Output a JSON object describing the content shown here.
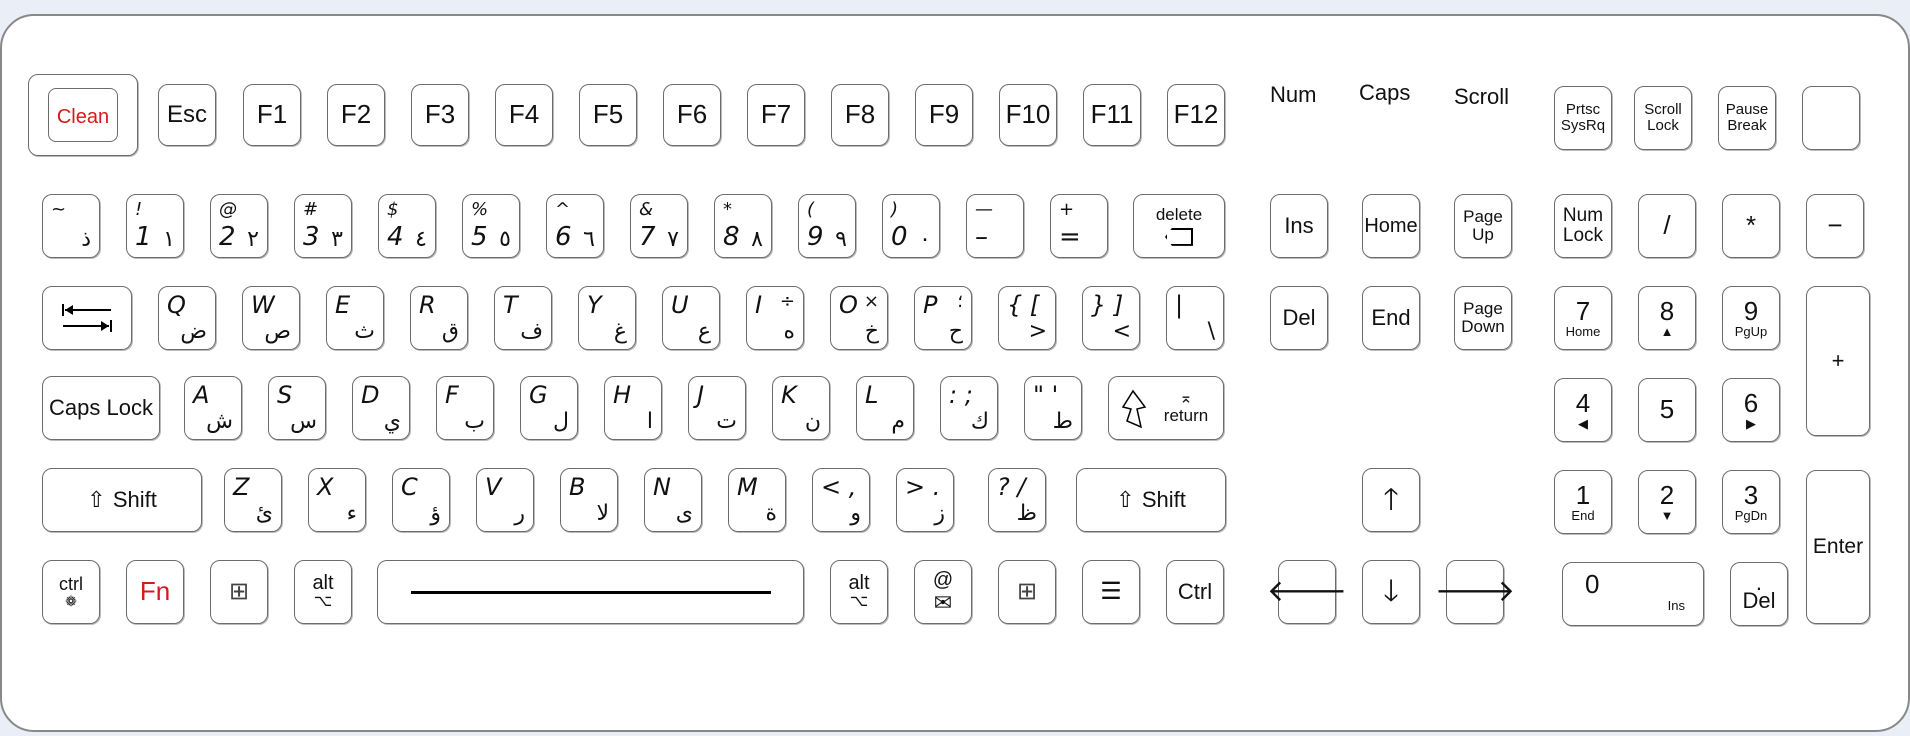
{
  "indicators": {
    "num": "Num",
    "caps": "Caps",
    "scroll": "Scroll"
  },
  "fkeys": {
    "clean": "Clean",
    "esc": "Esc",
    "f1": "F1",
    "f2": "F2",
    "f3": "F3",
    "f4": "F4",
    "f5": "F5",
    "f6": "F6",
    "f7": "F7",
    "f8": "F8",
    "f9": "F9",
    "f10": "F10",
    "f11": "F11",
    "f12": "F12"
  },
  "sys": {
    "prtsc": "Prtsc",
    "sysrq": "SysRq",
    "scroll": "Scroll",
    "lock": "Lock",
    "pause": "Pause",
    "break": "Break"
  },
  "numrow": [
    {
      "t": "~",
      "l": "",
      "ar": "ذ"
    },
    {
      "t": "!",
      "l": "1",
      "ar": "١"
    },
    {
      "t": "@",
      "l": "2",
      "ar": "٢"
    },
    {
      "t": "#",
      "l": "3",
      "ar": "٣"
    },
    {
      "t": "$",
      "l": "4",
      "ar": "٤"
    },
    {
      "t": "%",
      "l": "5",
      "ar": "٥"
    },
    {
      "t": "^",
      "l": "6",
      "ar": "٦"
    },
    {
      "t": "&",
      "l": "7",
      "ar": "٧"
    },
    {
      "t": "*",
      "l": "8",
      "ar": "٨"
    },
    {
      "t": "(",
      "l": "9",
      "ar": "٩"
    },
    {
      "t": ")",
      "l": "0",
      "ar": "٠"
    },
    {
      "t": "—",
      "l": "–",
      "ar": ""
    },
    {
      "t": "+",
      "l": "=",
      "ar": ""
    }
  ],
  "delete_label": "delete",
  "qrow": [
    {
      "l": "Q",
      "ar": "ض",
      "tr": ""
    },
    {
      "l": "W",
      "ar": "ص",
      "tr": ""
    },
    {
      "l": "E",
      "ar": "ث",
      "tr": ""
    },
    {
      "l": "R",
      "ar": "ق",
      "tr": ""
    },
    {
      "l": "T",
      "ar": "ف",
      "tr": ""
    },
    {
      "l": "Y",
      "ar": "غ",
      "tr": ""
    },
    {
      "l": "U",
      "ar": "ع",
      "tr": ""
    },
    {
      "l": "I",
      "ar": "ه",
      "tr": "÷"
    },
    {
      "l": "O",
      "ar": "خ",
      "tr": "×"
    },
    {
      "l": "P",
      "ar": "ح",
      "tr": "؛"
    },
    {
      "l": "{ [",
      "ar": ">",
      "tr": ""
    },
    {
      "l": "} ]",
      "ar": "<",
      "tr": ""
    },
    {
      "l": "|",
      "ar": "\\",
      "tr": ""
    }
  ],
  "caps_label": "Caps Lock",
  "arow": [
    {
      "l": "A",
      "ar": "ش"
    },
    {
      "l": "S",
      "ar": "س"
    },
    {
      "l": "D",
      "ar": "ي"
    },
    {
      "l": "F",
      "ar": "ب"
    },
    {
      "l": "G",
      "ar": "ل"
    },
    {
      "l": "H",
      "ar": "ا"
    },
    {
      "l": "J",
      "ar": "ت"
    },
    {
      "l": "K",
      "ar": "ن"
    },
    {
      "l": "L",
      "ar": "م"
    },
    {
      "l": ": ;",
      "ar": "ك"
    },
    {
      "l": "\" '",
      "ar": "ط"
    }
  ],
  "return_label": "return",
  "shift_label": "Shift",
  "zrow": [
    {
      "l": "Z",
      "ar": "ئ"
    },
    {
      "l": "X",
      "ar": "ء"
    },
    {
      "l": "C",
      "ar": "ؤ"
    },
    {
      "l": "V",
      "ar": "ر"
    },
    {
      "l": "B",
      "ar": "لا"
    },
    {
      "l": "N",
      "ar": "ى"
    },
    {
      "l": "M",
      "ar": "ة"
    },
    {
      "l": "< ,",
      "ar": "و"
    },
    {
      "l": "> .",
      "ar": "ز"
    },
    {
      "l": "? /",
      "ar": "ظ"
    }
  ],
  "bottom": {
    "ctrl": "ctrl",
    "fn": "Fn",
    "alt": "alt",
    "at": "@",
    "ctrl_r": "Ctrl"
  },
  "nav": {
    "ins": "Ins",
    "home": "Home",
    "page_up_1": "Page",
    "page_up_2": "Up",
    "del": "Del",
    "end": "End",
    "page_down_1": "Page",
    "page_down_2": "Down"
  },
  "numpad": {
    "numlock_1": "Num",
    "numlock_2": "Lock",
    "slash": "/",
    "star": "*",
    "minus": "−",
    "plus": "+",
    "n7": "7",
    "n7s": "Home",
    "n8": "8",
    "n9": "9",
    "n9s": "PgUp",
    "n4": "4",
    "n5": "5",
    "n6": "6",
    "n1": "1",
    "n1s": "End",
    "n2": "2",
    "n3": "3",
    "n3s": "PgDn",
    "n0": "0",
    "n0s": "Ins",
    "dot": ".",
    "dots": "Del",
    "enter": "Enter"
  },
  "colors": {
    "red": "#d21c1c",
    "border": "#6c6c6c"
  }
}
